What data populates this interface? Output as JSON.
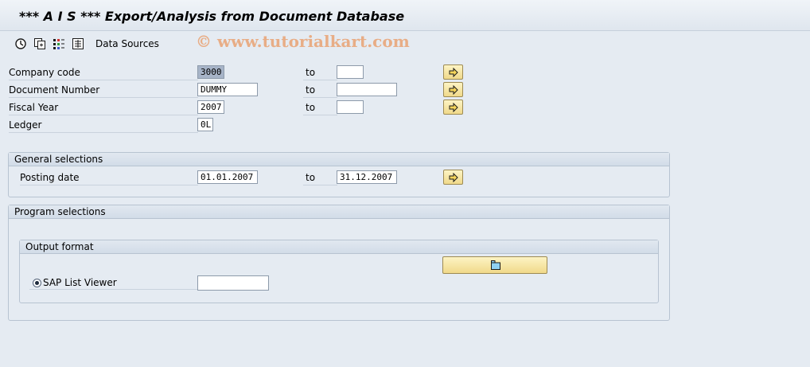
{
  "window": {
    "title": "*** A I S *** Export/Analysis from Document Database"
  },
  "toolbar": {
    "icons": [
      "execute-icon",
      "copy-variant-icon",
      "selection-options-icon",
      "multiple-selection-icon"
    ],
    "data_sources_label": "Data Sources"
  },
  "watermark": "© www.tutorialkart.com",
  "selection": {
    "to_label": "to",
    "rows": [
      {
        "label": "Company code",
        "from": "3000",
        "to": ""
      },
      {
        "label": "Document Number",
        "from": "DUMMY",
        "to": ""
      },
      {
        "label": "Fiscal Year",
        "from": "2007",
        "to": ""
      },
      {
        "label": "Ledger",
        "from": "0L"
      }
    ]
  },
  "general": {
    "title": "General selections",
    "posting_label": "Posting date",
    "posting_from": "01.01.2007",
    "to_label": "to",
    "posting_to": "31.12.2007"
  },
  "program": {
    "title": "Program selections",
    "output_title": "Output format",
    "sap_list_viewer_label": "SAP List Viewer",
    "sap_list_viewer_selected": true,
    "layout_value": ""
  },
  "colors": {
    "background": "#e5ebf2",
    "button_yellow": "#f7e7a6",
    "selected_field": "#a7b4c8"
  }
}
